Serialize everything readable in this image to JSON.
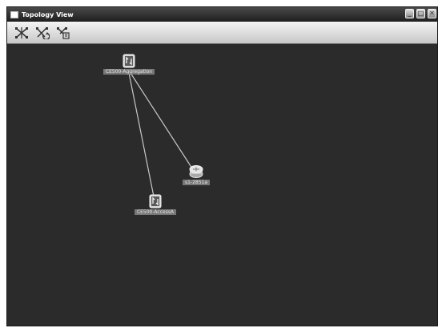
{
  "window": {
    "title": "Topology View",
    "controls": [
      {
        "name": "minimize",
        "glyph": "_"
      },
      {
        "name": "maximize",
        "glyph": "□"
      },
      {
        "name": "close",
        "glyph": "✕"
      }
    ]
  },
  "toolbar": {
    "tools": [
      "layout-tool-icon",
      "refresh-layout-tool-icon",
      "filter-tool-icon"
    ]
  },
  "topology": {
    "nodes": [
      {
        "id": "aggregation",
        "label": "CE500-Aggregation",
        "type": "switch"
      },
      {
        "id": "access",
        "label": "CE500-AccessA",
        "type": "switch"
      },
      {
        "id": "router",
        "label": "s1-2851a",
        "type": "router"
      }
    ],
    "links": [
      {
        "from": "aggregation",
        "to": "access"
      },
      {
        "from": "aggregation",
        "to": "router"
      }
    ]
  },
  "colors": {
    "canvas_background": "#2b2b2b",
    "link_line": "#c8c8c8",
    "label_background": "#777777",
    "label_text": "#e6e6e6"
  }
}
